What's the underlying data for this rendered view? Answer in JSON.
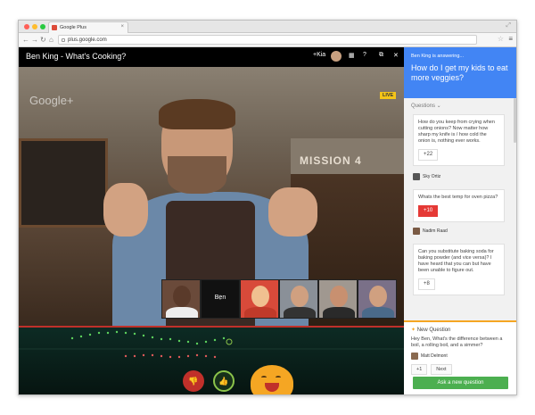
{
  "browser": {
    "tab_title": "Google Plus",
    "url": "plus.google.com"
  },
  "video": {
    "title": "Ben King - What's Cooking?",
    "add_label": "+Kia",
    "watermark": "Google+",
    "live_badge": "LIVE",
    "sign_text": "MISSION 4",
    "selected_participant": "Ben"
  },
  "panel": {
    "answering_label": "Ben King is answering...",
    "current_question": "How do I get my kids to eat more veggies?",
    "questions_header": "Questions ⌄",
    "questions": [
      {
        "text": "How do you keep from crying when cutting onions? Now matter how sharp my knife is / how cold the onion is, nothing ever works.",
        "votes": "+22",
        "author": "Sky Ortiz"
      },
      {
        "text": "Whats the best temp for oven pizza?",
        "votes": "+10",
        "author": "Nadim Raad"
      },
      {
        "text": "Can you substitute baking soda for baking powder (and vice versa)? I have heard that you can but have been unable to figure out.",
        "votes": "+8",
        "author": ""
      }
    ],
    "new_question": {
      "title": "New Question",
      "text": "Hey Ben, What's the difference between a boil, a rolling boil, and a simmer?",
      "author": "Matt Delmont",
      "plus_label": "+1",
      "next_label": "Next"
    },
    "ask_button": "Ask a new question"
  },
  "colors": {
    "accent_blue": "#4285f4",
    "live_yellow": "#f5c518",
    "vote_red": "#e53935",
    "ask_green": "#4caf50",
    "new_question_orange": "#f5a623"
  }
}
